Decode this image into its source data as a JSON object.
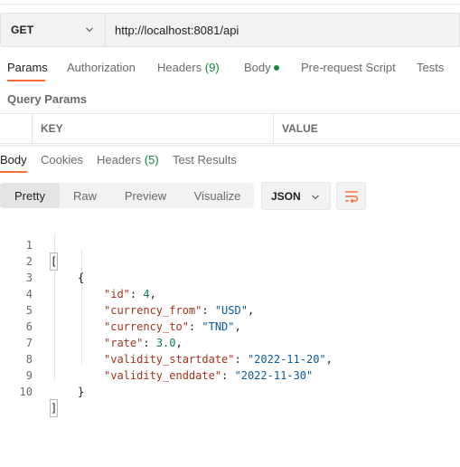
{
  "request": {
    "method": "GET",
    "url": "http://localhost:8081/api"
  },
  "request_tabs": [
    {
      "label": "Params"
    },
    {
      "label": "Authorization"
    },
    {
      "label": "Headers",
      "count": "(9)"
    },
    {
      "label": "Body"
    },
    {
      "label": "Pre-request Script"
    },
    {
      "label": "Tests"
    }
  ],
  "query_params": {
    "title": "Query Params",
    "columns": [
      "KEY",
      "VALUE"
    ]
  },
  "response_tabs": [
    {
      "label": "Body"
    },
    {
      "label": "Cookies"
    },
    {
      "label": "Headers",
      "count": "(5)"
    },
    {
      "label": "Test Results"
    }
  ],
  "view_modes": [
    "Pretty",
    "Raw",
    "Preview",
    "Visualize"
  ],
  "format": "JSON",
  "icons": {
    "method_dropdown": "chevron-down-icon",
    "format_dropdown": "chevron-down-icon",
    "wrap": "wrap-lines-icon",
    "body_indicator": "dot-icon"
  },
  "colors": {
    "accent": "#ff6c37",
    "count_green": "#0f8a3c",
    "json_key": "#a0341c",
    "json_string": "#0b5a9c",
    "json_number": "#0b7a5f"
  },
  "response_body": {
    "line_numbers": [
      "1",
      "2",
      "3",
      "4",
      "5",
      "6",
      "7",
      "8",
      "9",
      "10"
    ],
    "open_array": "[",
    "open_object": "{",
    "fields": [
      {
        "key": "\"id\"",
        "value": "4",
        "type": "number",
        "comma": ","
      },
      {
        "key": "\"currency_from\"",
        "value": "\"USD\"",
        "type": "string",
        "comma": ","
      },
      {
        "key": "\"currency_to\"",
        "value": "\"TND\"",
        "type": "string",
        "comma": ","
      },
      {
        "key": "\"rate\"",
        "value": "3.0",
        "type": "number",
        "comma": ","
      },
      {
        "key": "\"validity_startdate\"",
        "value": "\"2022-11-20\"",
        "type": "string",
        "comma": ","
      },
      {
        "key": "\"validity_enddate\"",
        "value": "\"2022-11-30\"",
        "type": "string",
        "comma": ""
      }
    ],
    "close_object": "}",
    "close_array": "]"
  }
}
